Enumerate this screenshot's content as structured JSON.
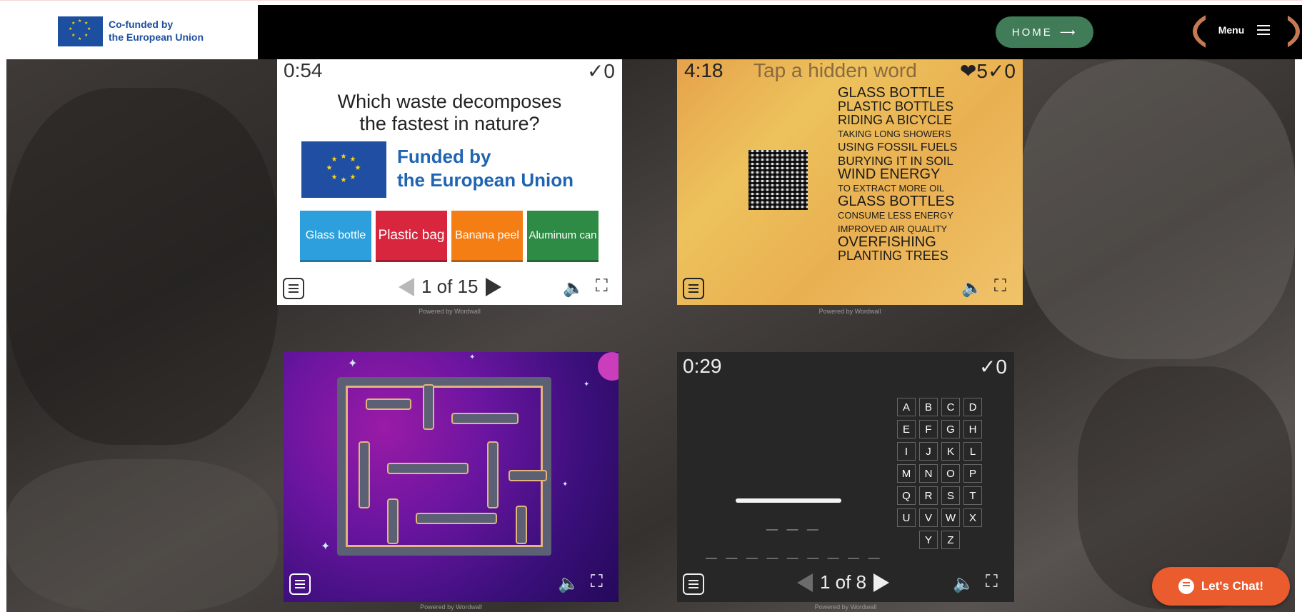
{
  "header": {
    "logo_line1": "Co-funded by",
    "logo_line2": "the European Union",
    "home_label": "HOME",
    "home_arrow": "⟶",
    "menu_label": "Menu"
  },
  "quiz": {
    "timer": "0:54",
    "score": "✓0",
    "question_line1": "Which waste decomposes",
    "question_line2": "the fastest in nature?",
    "funded_line1": "Funded by",
    "funded_line2": "the European Union",
    "answers": [
      "Glass bottle",
      "Plastic bag",
      "Banana peel",
      "Aluminum can"
    ],
    "pager": "1 of 15",
    "powered": "Powered by Wordwall"
  },
  "hidden_word": {
    "timer": "4:18",
    "hint": "Tap a hidden word",
    "lives": "❤5✓0",
    "words": [
      "GLASS BOTTLE",
      "PLASTIC BOTTLES",
      "RIDING A BICYCLE",
      "TAKING LONG SHOWERS",
      "USING FOSSIL FUELS",
      "BURYING IT IN SOIL",
      "WIND ENERGY",
      "TO EXTRACT MORE OIL",
      "GLASS BOTTLES",
      "CONSUME LESS ENERGY",
      "IMPROVED AIR QUALITY",
      "OVERFISHING",
      "PLANTING TREES"
    ],
    "powered": "Powered by Wordwall"
  },
  "maze": {
    "powered": "Powered by Wordwall"
  },
  "hangman": {
    "timer": "0:29",
    "score": "✓0",
    "letters": [
      "A",
      "B",
      "C",
      "D",
      "E",
      "F",
      "G",
      "H",
      "I",
      "J",
      "K",
      "L",
      "M",
      "N",
      "O",
      "P",
      "Q",
      "R",
      "S",
      "T",
      "U",
      "V",
      "W",
      "X",
      "Y",
      "Z"
    ],
    "pager": "1 of 8",
    "powered": "Powered by Wordwall"
  },
  "chat": {
    "label": "Let's Chat!"
  },
  "colors": {
    "header_bg": "#000000",
    "home_green": "#3f7c57",
    "chat_orange": "#ea5b2e",
    "eu_blue": "#1c4fa0"
  }
}
